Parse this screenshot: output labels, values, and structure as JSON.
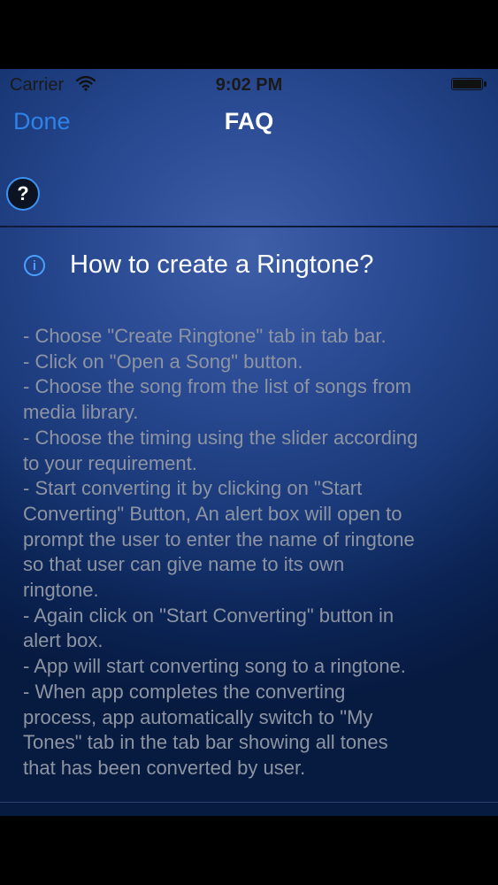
{
  "status_bar": {
    "carrier": "Carrier",
    "time": "9:02 PM"
  },
  "nav": {
    "done_label": "Done",
    "title": "FAQ"
  },
  "help_button": {
    "label": "?"
  },
  "section": {
    "icon": "info-icon",
    "title": "How to create a Ringtone?"
  },
  "faq_lines": [
    "- Choose \"Create Ringtone\" tab in tab bar.",
    "- Click on \"Open a Song\" button.",
    "- Choose the song from the list of songs from",
    "media library.",
    "- Choose the timing using the slider according",
    "to your requirement.",
    "- Start converting it by clicking on \"Start",
    "Converting\" Button, An alert box will open to",
    "prompt the user to enter the name of ringtone",
    "so that user can give name to its own",
    "ringtone.",
    "- Again click on \"Start Converting\" button in",
    "alert box.",
    "- App will start converting song to a ringtone.",
    "- When app completes the converting",
    "process, app automatically switch to \"My",
    "Tones\" tab in the tab bar showing all tones",
    "that has been converted by user."
  ],
  "colors": {
    "accent": "#2f82e8",
    "body_text": "#8d94a2",
    "title_text": "#ffffff",
    "background_center": "#3f5fa9",
    "background_edge": "#071a40"
  }
}
